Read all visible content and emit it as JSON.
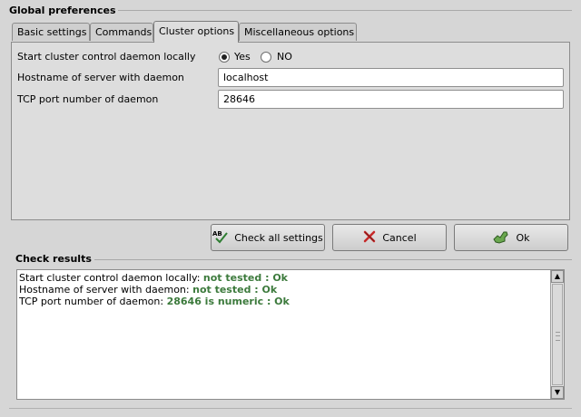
{
  "window": {
    "group_title": "Global preferences"
  },
  "tabs": [
    {
      "label": "Basic settings"
    },
    {
      "label": "Commands"
    },
    {
      "label": "Cluster options",
      "active": true
    },
    {
      "label": "Miscellaneous options"
    }
  ],
  "cluster": {
    "start_label": "Start cluster control daemon locally",
    "yes_label": "Yes",
    "no_label": "NO",
    "selected": "Yes",
    "hostname_label": "Hostname of server with daemon",
    "hostname_value": "localhost",
    "port_label": "TCP port number of daemon",
    "port_value": "28646"
  },
  "buttons": {
    "check_all": "Check all settings",
    "cancel": "Cancel",
    "ok": "Ok"
  },
  "results": {
    "title": "Check results",
    "lines": [
      {
        "label": "Start cluster control daemon locally:",
        "status": "not tested : Ok"
      },
      {
        "label": "Hostname of server with daemon:",
        "status": "not tested : Ok"
      },
      {
        "label": "TCP port number of daemon:",
        "status": "28646 is numeric : Ok"
      }
    ],
    "status_color": "#3c7a3c"
  },
  "icons": {
    "check_all": "spellcheck-icon",
    "cancel": "cross-icon",
    "ok": "ok-hand-icon"
  }
}
